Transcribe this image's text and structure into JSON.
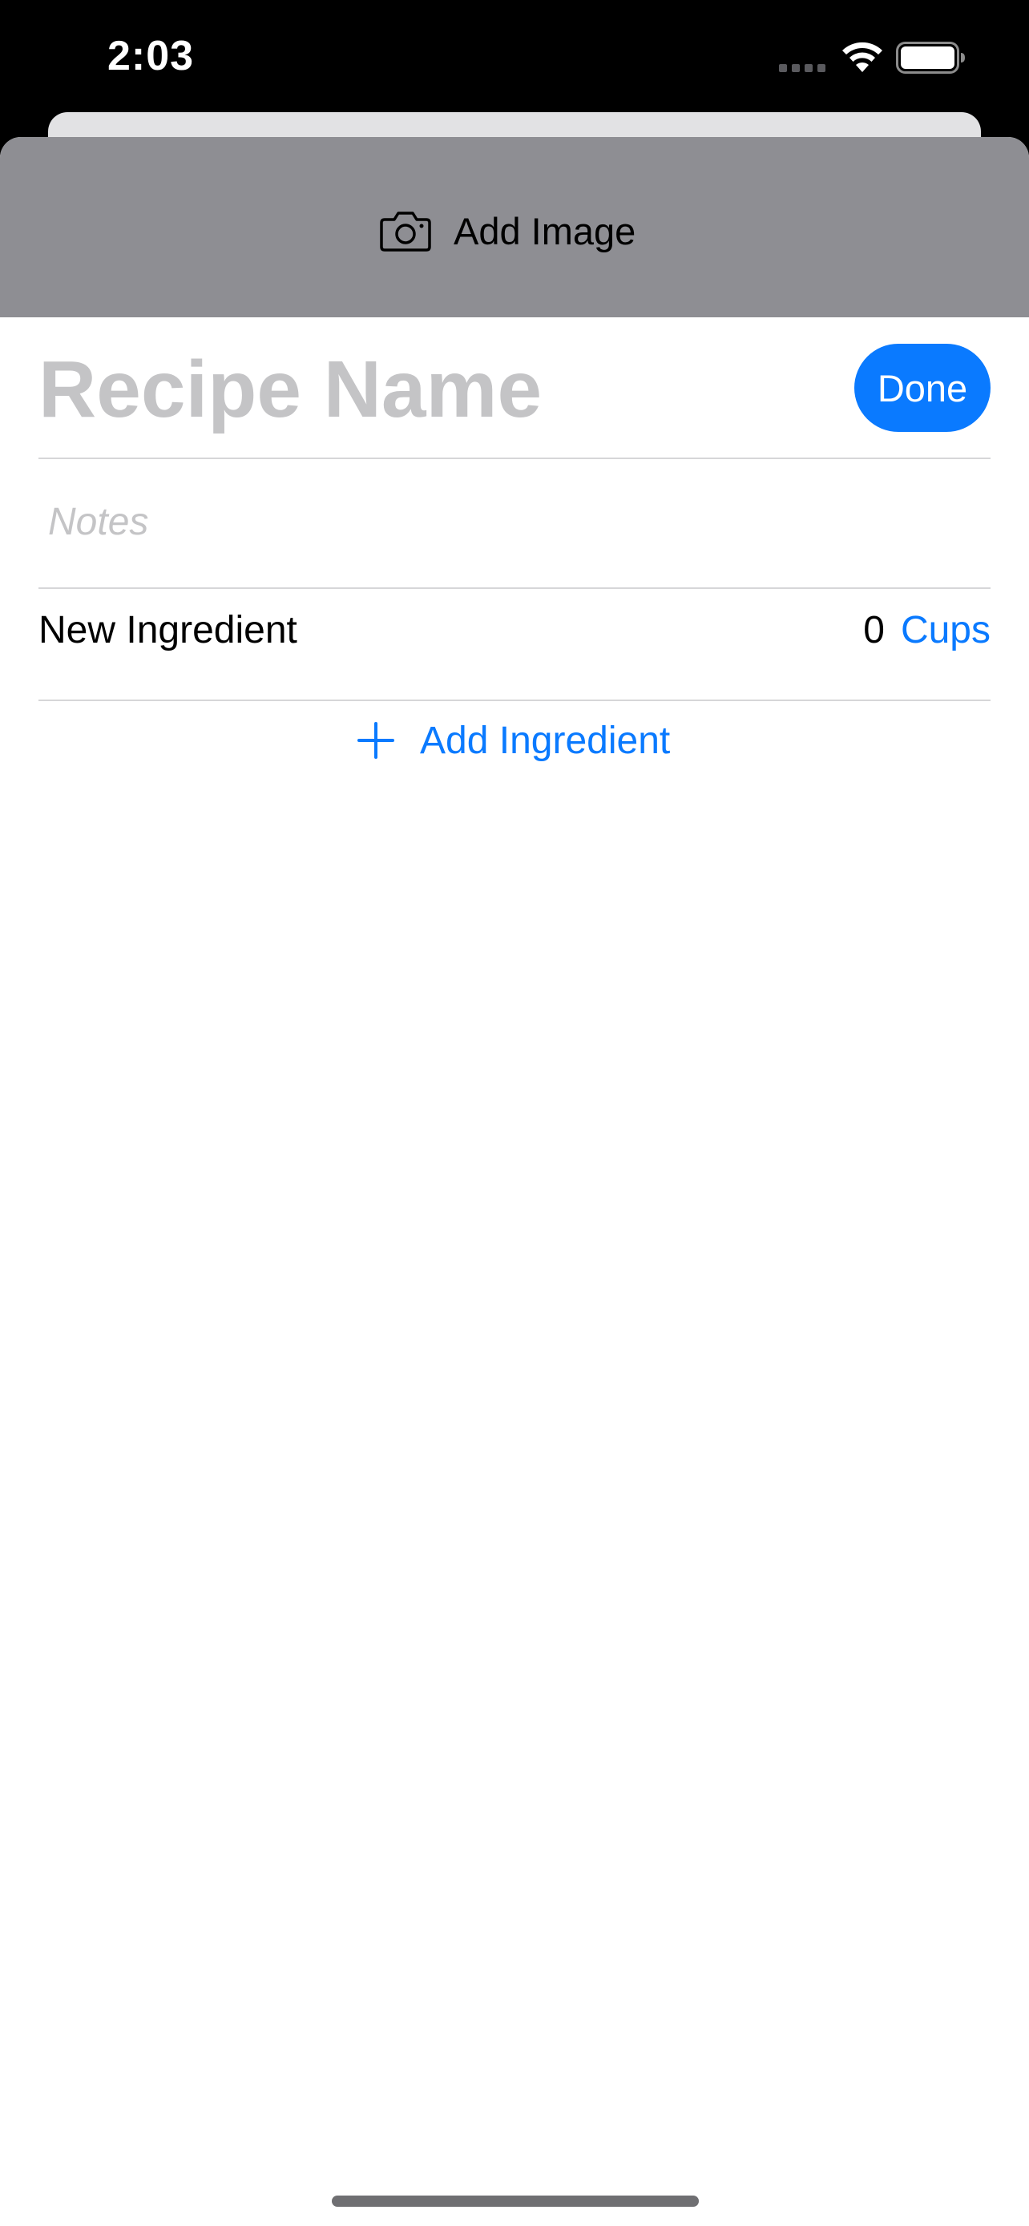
{
  "status_bar": {
    "time": "2:03"
  },
  "icons": {
    "signal": "cellular-signal-icon",
    "wifi": "wifi-icon",
    "battery": "battery-icon",
    "camera": "camera-icon",
    "plus": "plus-icon"
  },
  "header": {
    "add_image_label": "Add Image"
  },
  "form": {
    "recipe_name_placeholder": "Recipe Name",
    "recipe_name_value": "",
    "done_label": "Done",
    "notes_placeholder": "Notes",
    "notes_value": ""
  },
  "ingredients": [
    {
      "name": "New Ingredient",
      "quantity": "0",
      "unit": "Cups"
    }
  ],
  "add_ingredient_label": "Add Ingredient",
  "colors": {
    "accent": "#0a7aff",
    "header_gray": "#8e8e93",
    "placeholder": "#c4c4c6",
    "divider": "#d6d6d8"
  }
}
